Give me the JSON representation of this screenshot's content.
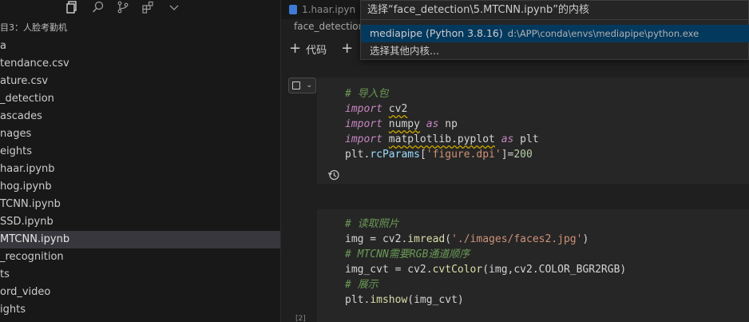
{
  "sidebar": {
    "project_label": "目3：人脸考勤机",
    "items": [
      {
        "label": "a"
      },
      {
        "label": "tendance.csv"
      },
      {
        "label": "ature.csv"
      },
      {
        "label": "_detection"
      },
      {
        "label": "ascades"
      },
      {
        "label": "nages"
      },
      {
        "label": "eights"
      },
      {
        "label": "haar.ipynb"
      },
      {
        "label": "hog.ipynb"
      },
      {
        "label": "TCNN.ipynb"
      },
      {
        "label": "SSD.ipynb"
      },
      {
        "label": "MTCNN.ipynb",
        "active": true
      },
      {
        "label": "_recognition"
      },
      {
        "label": "ts"
      },
      {
        "label": "ord_video"
      },
      {
        "label": "ights"
      }
    ]
  },
  "editor": {
    "tab_label": "1.haar.ipyn",
    "breadcrumb": "face_detection",
    "toolbar": {
      "code_label": "代码",
      "plus": "+"
    },
    "exec_count": "[2]"
  },
  "kernel_picker": {
    "prompt": "选择“face_detection\\5.MTCNN.ipynb”的内核",
    "items": [
      {
        "name": "mediapipe (Python 3.8.16)",
        "path": "d:\\APP\\conda\\envs\\mediapipe\\python.exe"
      },
      {
        "name": "选择其他内核...",
        "path": ""
      }
    ]
  },
  "cells": [
    {
      "lines": [
        [
          {
            "t": "# 导入包",
            "c": "cmt"
          }
        ],
        [
          {
            "t": "import",
            "c": "kw"
          },
          {
            "t": " ",
            "c": "txt"
          },
          {
            "t": "cv2",
            "c": "txt squig"
          }
        ],
        [
          {
            "t": "import",
            "c": "kw"
          },
          {
            "t": " ",
            "c": "txt"
          },
          {
            "t": "numpy",
            "c": "txt squig"
          },
          {
            "t": " ",
            "c": "txt"
          },
          {
            "t": "as",
            "c": "kw"
          },
          {
            "t": " np",
            "c": "txt"
          }
        ],
        [
          {
            "t": "import",
            "c": "kw"
          },
          {
            "t": " ",
            "c": "txt"
          },
          {
            "t": "matplotlib.pyplot",
            "c": "txt squig"
          },
          {
            "t": " ",
            "c": "txt"
          },
          {
            "t": "as",
            "c": "kw"
          },
          {
            "t": " plt",
            "c": "txt"
          }
        ],
        [
          {
            "t": "plt",
            "c": "txt"
          },
          {
            "t": ".",
            "c": "txt"
          },
          {
            "t": "rcParams",
            "c": "var"
          },
          {
            "t": "[",
            "c": "txt"
          },
          {
            "t": "'figure.dpi'",
            "c": "str"
          },
          {
            "t": "]=",
            "c": "txt"
          },
          {
            "t": "200",
            "c": "num"
          }
        ]
      ]
    },
    {
      "lines": [
        [
          {
            "t": "# 读取照片",
            "c": "cmt"
          }
        ],
        [
          {
            "t": "img",
            "c": "txt"
          },
          {
            "t": " = cv2.",
            "c": "txt"
          },
          {
            "t": "imread",
            "c": "fn"
          },
          {
            "t": "(",
            "c": "txt"
          },
          {
            "t": "'./images/faces2.jpg'",
            "c": "str"
          },
          {
            "t": ")",
            "c": "txt"
          }
        ],
        [
          {
            "t": "# MTCNN需要RGB通道顺序",
            "c": "cmt"
          }
        ],
        [
          {
            "t": "img_cvt",
            "c": "txt"
          },
          {
            "t": " = cv2.",
            "c": "txt"
          },
          {
            "t": "cvtColor",
            "c": "fn"
          },
          {
            "t": "(img,cv2.COLOR_BGR2RGB)",
            "c": "txt"
          }
        ],
        [
          {
            "t": "# 展示",
            "c": "cmt"
          }
        ],
        [
          {
            "t": "plt",
            "c": "txt"
          },
          {
            "t": ".",
            "c": "txt"
          },
          {
            "t": "imshow",
            "c": "fn"
          },
          {
            "t": "(img_cvt)",
            "c": "txt"
          }
        ]
      ]
    }
  ]
}
